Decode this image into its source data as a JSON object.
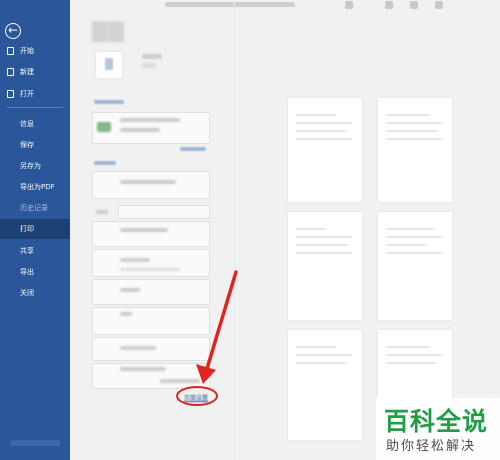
{
  "sidebar": {
    "back": "←",
    "items": [
      {
        "label": "开始",
        "icon": "home-icon"
      },
      {
        "label": "新建",
        "icon": "new-document-icon"
      },
      {
        "label": "打开",
        "icon": "folder-open-icon"
      },
      {
        "label": "信息"
      },
      {
        "label": "保存"
      },
      {
        "label": "另存为"
      },
      {
        "label": "导出为PDF"
      },
      {
        "label": "历史记录"
      },
      {
        "label": "打印"
      },
      {
        "label": "共享"
      },
      {
        "label": "导出"
      },
      {
        "label": "关闭"
      }
    ],
    "active_item": "打印",
    "bg_color": "#2b579a"
  },
  "print_panel": {
    "page_setup_link": "页面设置"
  },
  "annotation": {
    "color": "#e0241f"
  },
  "watermark": {
    "title": "百科全说",
    "subtitle": "助你轻松解决",
    "color": "#1f9e46"
  }
}
